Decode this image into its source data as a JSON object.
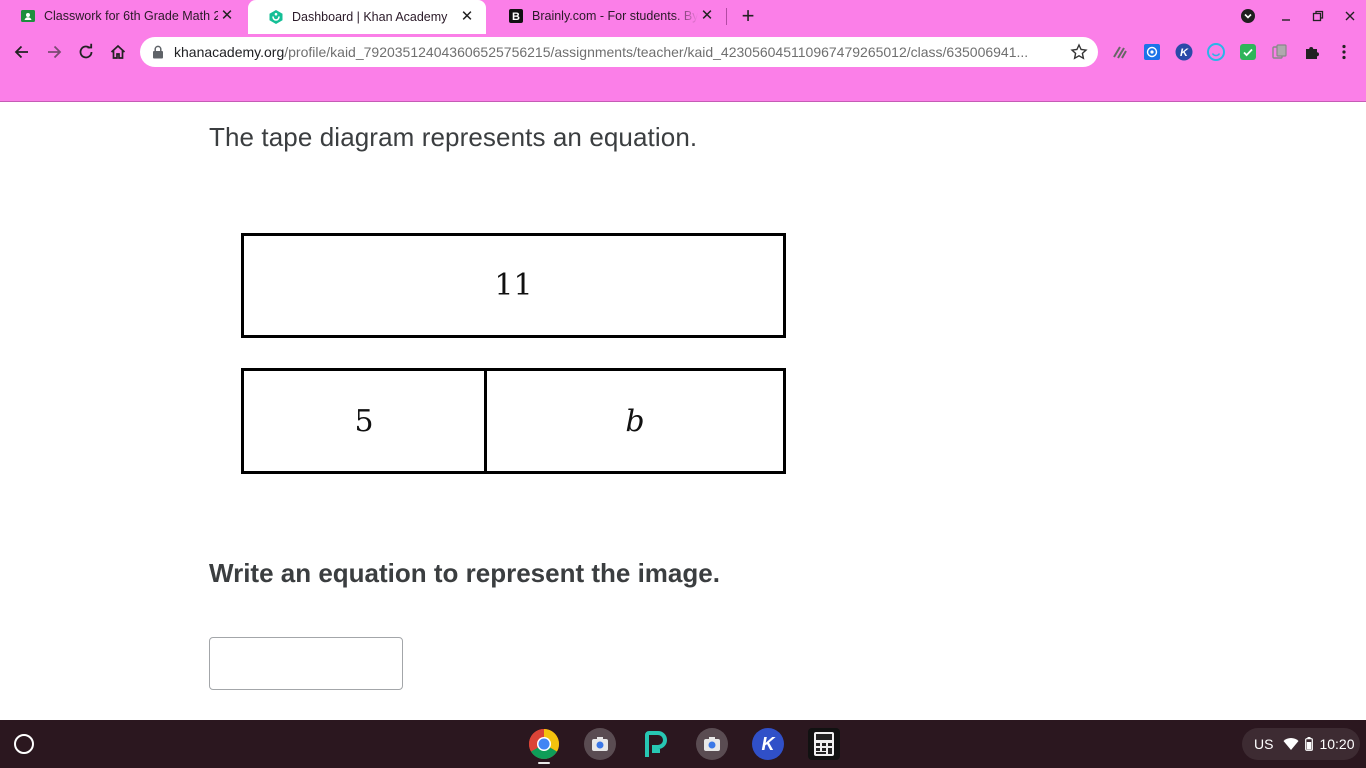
{
  "browser": {
    "tabs": [
      {
        "title": "Classwork for 6th Grade Math 2",
        "active": false
      },
      {
        "title": "Dashboard | Khan Academy",
        "active": true
      },
      {
        "title": "Brainly.com - For students. By students.",
        "active": false
      }
    ],
    "url_host": "khanacademy.org",
    "url_path": "/profile/kaid_792035124043606525756215/assignments/teacher/kaid_423056045110967479265012/class/635006941..."
  },
  "exercise": {
    "prompt": "The tape diagram represents an equation.",
    "tape_top_label": "11",
    "tape_bottom_labels": [
      "5",
      "b"
    ],
    "tape_bottom_fraction": 0.45,
    "question": "Write an equation to represent the image.",
    "answer_value": ""
  },
  "shelf": {
    "apps": [
      "chrome-icon",
      "camera-icon",
      "pear-deck-icon",
      "camera-icon",
      "khan-kids-icon",
      "calculator-icon"
    ],
    "tray": {
      "language": "US",
      "time": "10:20"
    }
  },
  "colors": {
    "chrome_bg": "#fb7fe8",
    "shelf_bg": "#2b171f",
    "text_dark": "#3b3e40"
  }
}
